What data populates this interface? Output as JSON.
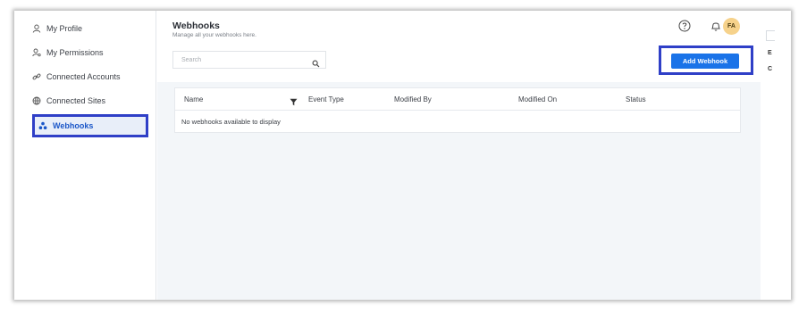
{
  "sidebar": {
    "items": [
      {
        "label": "My Profile",
        "icon": "user-icon"
      },
      {
        "label": "My Permissions",
        "icon": "user-key-icon"
      },
      {
        "label": "Connected Accounts",
        "icon": "link-icon"
      },
      {
        "label": "Connected Sites",
        "icon": "globe-icon"
      },
      {
        "label": "Webhooks",
        "icon": "webhook-icon",
        "active": true
      }
    ]
  },
  "header": {
    "title": "Webhooks",
    "subtitle": "Manage all your webhooks here.",
    "search_placeholder": "Search",
    "add_button": "Add Webhook",
    "avatar_initials": "FA"
  },
  "table": {
    "columns": [
      "Name",
      "Event Type",
      "Modified By",
      "Modified On",
      "Status"
    ],
    "empty_message": "No webhooks available to display"
  },
  "right_edge": {
    "letters": [
      "E",
      "C"
    ]
  },
  "colors": {
    "accent": "#1a73e8",
    "highlight_border": "#2f3fc7",
    "avatar": "#f6d28b"
  }
}
